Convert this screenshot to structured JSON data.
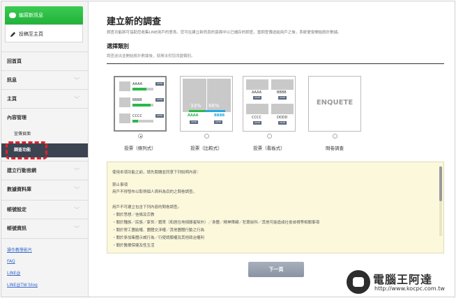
{
  "sidebar": {
    "new_message": "編寫新訊息",
    "post_home": "投稿至主頁",
    "nav": [
      {
        "label": "回首頁",
        "chevron": false
      },
      {
        "label": "訊息",
        "chevron": true
      },
      {
        "label": "主頁",
        "chevron": true
      },
      {
        "label": "內容管理",
        "chevron": false
      }
    ],
    "sub_items": [
      {
        "label": "宣傳頁面",
        "active": false
      },
      {
        "label": "調查功能",
        "active": true
      }
    ],
    "nav2": [
      {
        "label": "建立行動官網",
        "chevron": true
      },
      {
        "label": "數據資料庫",
        "chevron": true
      },
      {
        "label": "帳號設定",
        "chevron": true
      },
      {
        "label": "帳號資訊",
        "chevron": true
      }
    ],
    "footer_links": [
      "操作教學影片",
      "FAQ",
      "LINE@",
      "LINE@TW blog"
    ],
    "highlight_color": "#e5202a"
  },
  "main": {
    "title": "建立新的調查",
    "description": "調查功能將可協助您收集LINE用戶的意見。您可在建立新訊息的頁面中以已儲存的調查，當調查傳送給用戶之後，系統便會開始統計數據。",
    "section_title": "選擇類別",
    "section_desc": "調查送出並開始統計數據後，就無法供您改變類別。",
    "options": [
      {
        "label": "投票（條列式）",
        "selected": true,
        "rows": [
          "AAAA",
          "BBBB",
          "CCCC"
        ]
      },
      {
        "label": "投票（比較式）",
        "selected": false,
        "percents": [
          "33%",
          "66%"
        ],
        "names": [
          "AAAA",
          "BBBB"
        ]
      },
      {
        "label": "投票（看板式）",
        "selected": false,
        "names": [
          "AAAA",
          "BBBB",
          "CCCC",
          "DDDD"
        ]
      },
      {
        "label": "問卷調查",
        "selected": false,
        "card_text": "ENQUETE"
      }
    ],
    "vote_label": "VOTE",
    "notice": {
      "intro": "使用本項功能之前，請先閱讀並同意下列說明內容：",
      "heading1": "禁止事項",
      "line1": "用戶不得發布以取得個人資料為目的之問卷調查。",
      "heading2": "用戶不可建立包含下列內容的問卷調查。",
      "items": [
        "・關於思想／信條及宗教",
        "・關於種族／民族／家世／籍貫（和居住地相關者除外）／身體／精神障礙／犯罪前科／其他可能造成社會歧視等相關事項",
        "・關於勞工團結權、團體交涉權／其他團體行動之行為",
        "・關於參加集體示威行為／行使請願權及其他政治權利",
        "・關於醫療保健及性生活"
      ]
    },
    "next_button": "下一頁"
  },
  "watermark": {
    "title": "電腦王阿達",
    "url": "http://www.kocpc.com.tw"
  },
  "colors": {
    "green": "#2cb84a",
    "dark_nav": "#3c4452",
    "accent_blue": "#2aa8e0"
  }
}
